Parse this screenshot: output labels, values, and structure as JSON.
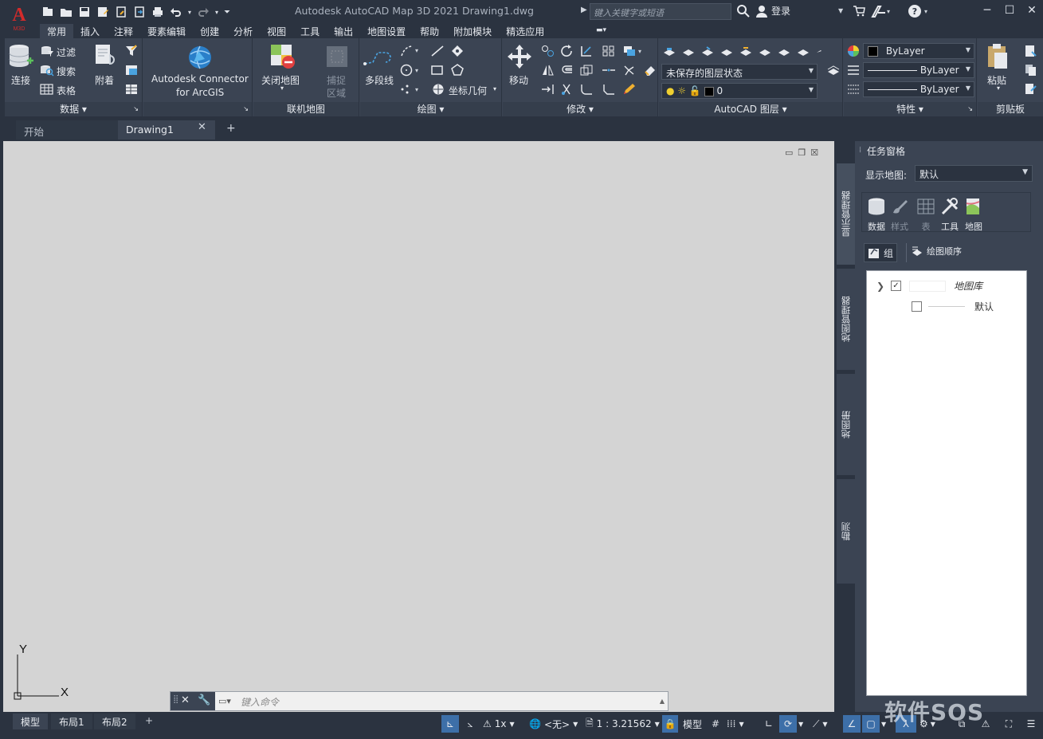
{
  "titlebar": {
    "logo_text": "A",
    "logo_sub": "M3D",
    "app_title": "Autodesk AutoCAD Map 3D 2021    Drawing1.dwg",
    "search_placeholder": "键入关键字或短语",
    "login_label": "登录"
  },
  "ribbon_tabs": [
    "常用",
    "插入",
    "注释",
    "要素编辑",
    "创建",
    "分析",
    "视图",
    "工具",
    "输出",
    "地图设置",
    "帮助",
    "附加模块",
    "精选应用"
  ],
  "ribbon": {
    "data_panel": {
      "title": "数据",
      "connect": "连接",
      "filter": "过滤",
      "search": "搜索",
      "table": "表格",
      "attach": "附着"
    },
    "arcgis_panel": {
      "label_line1": "Autodesk Connector",
      "label_line2": "for ArcGIS"
    },
    "online_map_panel": {
      "title": "联机地图",
      "close_map": "关闭地图",
      "capture_line1": "捕捉",
      "capture_line2": "区域"
    },
    "draw_panel": {
      "title": "绘图",
      "polyline": "多段线",
      "coord_geom": "坐标几何"
    },
    "modify_panel": {
      "title": "修改",
      "move": "移动"
    },
    "layers_panel": {
      "title": "AutoCAD 图层",
      "layer_state": "未保存的图层状态",
      "layer_name": "0"
    },
    "properties_panel": {
      "title": "特性",
      "color": "ByLayer",
      "linetype": "ByLayer",
      "lineweight": "ByLayer"
    },
    "clipboard_panel": {
      "title": "剪贴板",
      "paste": "粘贴"
    }
  },
  "doc_tabs": {
    "start": "开始",
    "drawing": "Drawing1"
  },
  "ucs": {
    "y": "Y",
    "x": "X"
  },
  "command_line": {
    "placeholder": "键入命令"
  },
  "side_tabs": [
    "显示管理器",
    "地图管理器",
    "地图册",
    "勘测"
  ],
  "taskpane": {
    "title": "任务窗格",
    "display_map_label": "显示地图:",
    "display_map_value": "默认",
    "tools": [
      "数据",
      "样式",
      "表",
      "工具",
      "地图"
    ],
    "group_label": "组",
    "draw_order_label": "绘图顺序",
    "tree": [
      {
        "label": "地图库",
        "checked": true
      },
      {
        "label": "默认",
        "checked": false
      }
    ]
  },
  "statusbar": {
    "layout_tabs": [
      "模型",
      "布局1",
      "布局2"
    ],
    "scale_factor": "1x",
    "coord_system": "<无>",
    "scale": "1 : 3.21562",
    "model": "模型"
  },
  "watermark": "软件SOS",
  "colors": {
    "background": "#2b3340",
    "ribbon": "#3b4453",
    "canvas": "#d4d4d4",
    "accent": "#3d6fa8",
    "logo_red": "#d22b2b"
  }
}
